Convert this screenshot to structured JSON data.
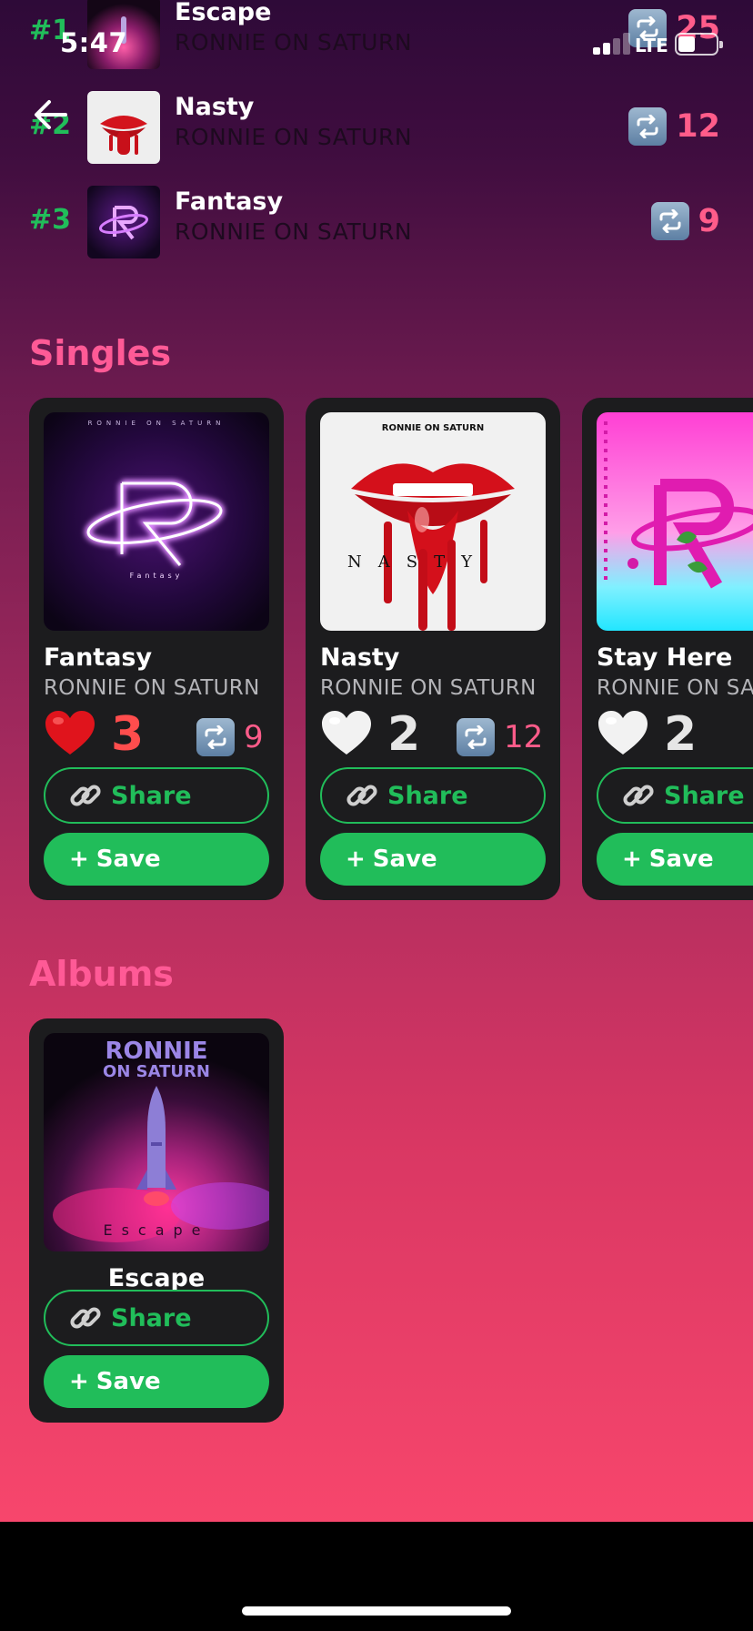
{
  "status": {
    "time": "5:47",
    "network": "LTE"
  },
  "top_tracks": [
    {
      "rank": "#1",
      "title": "Escape",
      "artist": "RONNIE ON SATURN",
      "reposts": "25"
    },
    {
      "rank": "#2",
      "title": "Nasty",
      "artist": "RONNIE ON SATURN",
      "reposts": "12"
    },
    {
      "rank": "#3",
      "title": "Fantasy",
      "artist": "RONNIE ON SATURN",
      "reposts": "9"
    }
  ],
  "singles": {
    "heading": "Singles",
    "items": [
      {
        "title": "Fantasy",
        "artist": "RONNIE ON SATURN",
        "likes": "3",
        "liked": true,
        "reposts": "9",
        "cover_text": "RONNIE ON SATURN",
        "cover_caption": "Fantasy",
        "share_label": "Share",
        "save_label": "Save"
      },
      {
        "title": "Nasty",
        "artist": "RONNIE ON SATURN",
        "likes": "2",
        "liked": false,
        "reposts": "12",
        "cover_text": "RONNIE ON SATURN",
        "cover_caption": "NASTY",
        "share_label": "Share",
        "save_label": "Save"
      },
      {
        "title": "Stay Here",
        "artist": "RONNIE ON SATURN",
        "likes": "2",
        "liked": false,
        "share_label": "Share",
        "save_label": "Save"
      }
    ]
  },
  "albums": {
    "heading": "Albums",
    "items": [
      {
        "title": "Escape",
        "cover_line1": "RONNIE",
        "cover_line2": "ON SATURN",
        "cover_caption": "Escape",
        "share_label": "Share",
        "save_label": "Save"
      }
    ]
  },
  "colors": {
    "accent_green": "#21bd5a",
    "accent_pink": "#ff5a96",
    "liked_red": "#ff4d4d",
    "card_bg": "#1c1c1e"
  }
}
